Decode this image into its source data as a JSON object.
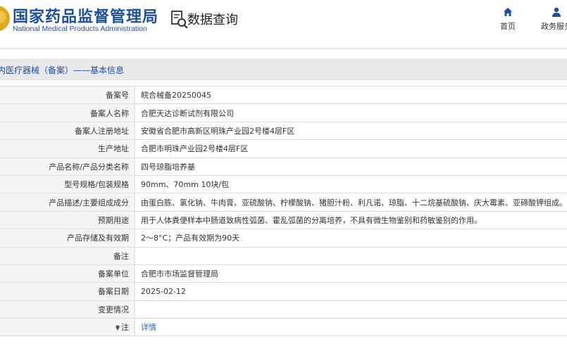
{
  "header": {
    "logo_cn": "国家药品监督管理局",
    "logo_en": "National Medical Products Administration",
    "title": "数据查询",
    "search_icon": "search-document-icon",
    "nav": [
      {
        "label": "首页",
        "icon": "home-icon"
      },
      {
        "label": "政务服务",
        "icon": "user-icon"
      }
    ]
  },
  "section": {
    "title": "内医疗器械（备案）——基本信息"
  },
  "table": {
    "rows": [
      {
        "label": "备案号",
        "value": "皖合械备20250045"
      },
      {
        "label": "备案人名称",
        "value": "合肥天达诊断试剂有限公司"
      },
      {
        "label": "备案人注册地址",
        "value": "安徽省合肥市高新区明珠产业园2号楼4层F区"
      },
      {
        "label": "生产地址",
        "value": "合肥市明珠产业园2号楼4层F区"
      },
      {
        "label": "产品名称/产品分类名称",
        "value": "四号琼脂培养基"
      },
      {
        "label": "型号规格/包装规格",
        "value": "90mm、70mm 10块/包"
      },
      {
        "label": "产品描述/主要组成成分",
        "value": "由蛋白胨、氯化钠、牛肉膏、亚硫酸钠、柠檬酸钠、猪胆汁粉、利凡诺、琼脂、十二烷基硫酸钠、庆大霉素、亚碲酸钾组成。"
      },
      {
        "label": "预期用途",
        "value": "用于人体粪便样本中肠道致病性弧菌、霍乱弧菌的分离培养，不具有微生物鉴别和药敏鉴别的作用。"
      },
      {
        "label": "产品存储及有效期",
        "value": "2～8°C；产品有效期为90天"
      },
      {
        "label": "备注",
        "value": ""
      },
      {
        "label": "备案单位",
        "value": "合肥市市场监督管理局"
      },
      {
        "label": "备案日期",
        "value": "2025-02-12"
      },
      {
        "label": "变更情况",
        "value": ""
      },
      {
        "label": "注",
        "value": "详情"
      }
    ]
  },
  "colors": {
    "brand": "#1e4f9c",
    "link": "#2a63b5",
    "label_bg": "#f5f5f5",
    "section_bg": "#e9e9e9"
  }
}
